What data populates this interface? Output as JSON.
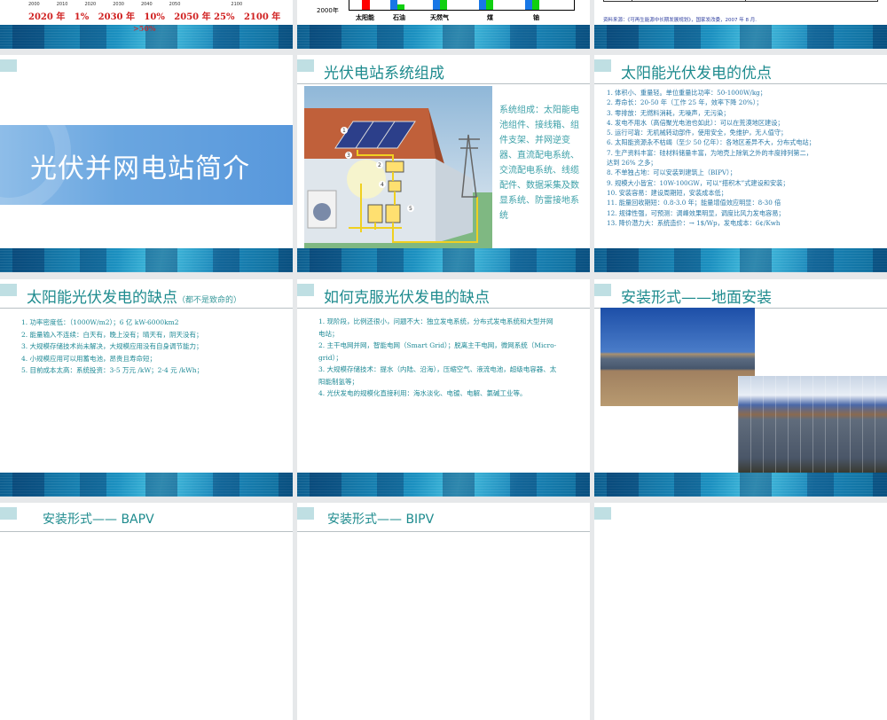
{
  "slides": {
    "s_top1": {
      "axis_ticks": [
        "2000",
        "2010",
        "2020",
        "2030",
        "2040",
        "2050",
        "2100"
      ],
      "milestones": "2020 年   1%   2030 年   10%   2050 年 25%   2100 年",
      "overflow": ">50%"
    },
    "s_top2": {
      "year_label": "2000年",
      "categories": [
        "太阳能",
        "石油",
        "天然气",
        "煤",
        "铀"
      ]
    },
    "s_top3": {
      "source": "资料来源：《可再生能源中长期发展规划》，国家发改委，2007 年 8 月."
    },
    "s1": {
      "title": "光伏并网电站简介"
    },
    "s2": {
      "title": "光伏电站系统组成",
      "desc": "系统组成：太阳能电池组件、接线箱、组件支架、并网逆变器、直流配电系统、交流配电系统、线缆配件、数据采集及数显系统、防雷接地系统",
      "callouts": [
        "1",
        "2",
        "3",
        "4",
        "5"
      ]
    },
    "s3": {
      "title": "太阳能光伏发电的优点",
      "items": [
        "1. 体积小、重量轻。单位重量比功率：50-1000W/kg；",
        "2. 寿命长：20-50 年（工作 25 年，效率下降 20%）；",
        "3. 零排放：无燃料消耗，无噪声，无污染；",
        "4.  发电不用水（高倍聚光电池也如此）：可以在荒漠地区建设；",
        "5.  运行可靠：无机械转动部件，使用安全，免维护，无人值守；",
        "6. 太阳能资源永不枯竭（至少 50 亿年）：各地区差异不大，分布式电站；",
        "7.  生产资料丰富：硅材料储量丰富，为地壳上除氧之外的丰度排列第二，",
        "达到 26% 之多；",
        "8.  不单独占地：可以安装到建筑上（BIPV）；",
        "9. 规模大小皆宜：10W-100GW，可以“搭积木”式建设和安装；",
        "10. 安装容易：建设周期短，安装成本低；",
        "11. 能量回收期短：0.8-3.0 年；能量增值效应明显：8-30 倍",
        "12. 规律性强，可预测：调峰效果明显，调度比风力发电容易；",
        "13. 降价潜力大：系统造价：→ 1$/Wp，发电成本：6¢/Kwh"
      ]
    },
    "s4": {
      "title": "太阳能光伏发电的缺点",
      "note": "（都不是致命的）",
      "items": [
        "1. 功率密度低：（1000W/m2）；6 亿 kW-6000km2",
        "2. 能量输入不连续：白天有，晚上没有；晴天有，阴天没有；",
        "3. 大规模存储技术尚未解决，大规模应用没有自身调节能力；",
        "4.  小规模应用可以用蓄电池，昂贵且寿命短；",
        "5.  目前成本太高：系统投资：3-5 万元 /kW；2-4 元 /kWh；"
      ]
    },
    "s5": {
      "title": "如何克服光伏发电的缺点",
      "items": [
        "1.   现阶段，比例还很小，问题不大：独立发电系统，分布式发电系统和大型并网电站；",
        "2.  主干电网并网，智能电网（Smart Grid）；脱离主干电网，微网系统（Micro-grid）；",
        "3.  大规模存储技术：提水（内陆、沿海），压缩空气、液流电池，超级电容器、太阳能制氢等；",
        "4.  光伏发电的规模化直接利用：海水淡化、电镀、电解、氯碱工业等。"
      ]
    },
    "s6": {
      "title": "安装形式——地面安装"
    },
    "s7": {
      "title": "安装形式—— BAPV"
    },
    "s8": {
      "title": "安装形式—— BIPV"
    }
  }
}
